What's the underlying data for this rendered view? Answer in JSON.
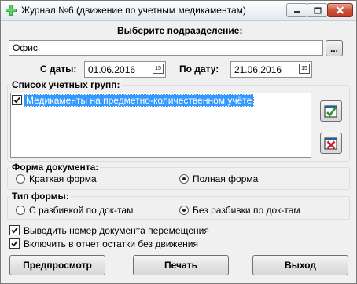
{
  "window": {
    "title": "Журнал №6 (движение по учетным медикаментам)",
    "icons": {
      "app": "green-cross-icon",
      "minimize": "minimize-icon",
      "maximize": "maximize-icon",
      "close": "close-icon"
    }
  },
  "department": {
    "label": "Выберите подразделение:",
    "value": "Офис",
    "browse_label": "..."
  },
  "dates": {
    "from_label": "С даты:",
    "from_value": "01.06.2016",
    "to_label": "По дату:",
    "to_value": "21.06.2016",
    "calendar_button_label": "15"
  },
  "groups": {
    "title": "Список учетных групп:",
    "items": [
      {
        "label": "Медикаменты на предметно-количественном учёте",
        "checked": true,
        "selected": true
      }
    ],
    "check_all_icon": "check-all-icon",
    "uncheck_all_icon": "uncheck-all-icon"
  },
  "form_type": {
    "title": "Форма документа:",
    "options": [
      {
        "label": "Краткая форма",
        "selected": false
      },
      {
        "label": "Полная форма",
        "selected": true
      }
    ]
  },
  "layout_type": {
    "title": "Тип формы:",
    "options": [
      {
        "label": "С разбивкой по док-там",
        "selected": false
      },
      {
        "label": "Без разбивки по док-там",
        "selected": true
      }
    ]
  },
  "options": [
    {
      "label": "Выводить номер документа перемещения",
      "checked": true
    },
    {
      "label": "Включить в отчет остатки без движения",
      "checked": true
    }
  ],
  "buttons": {
    "preview": "Предпросмотр",
    "print": "Печать",
    "exit": "Выход"
  },
  "colors": {
    "selection": "#3399ff",
    "close_button": "#c8553e"
  }
}
